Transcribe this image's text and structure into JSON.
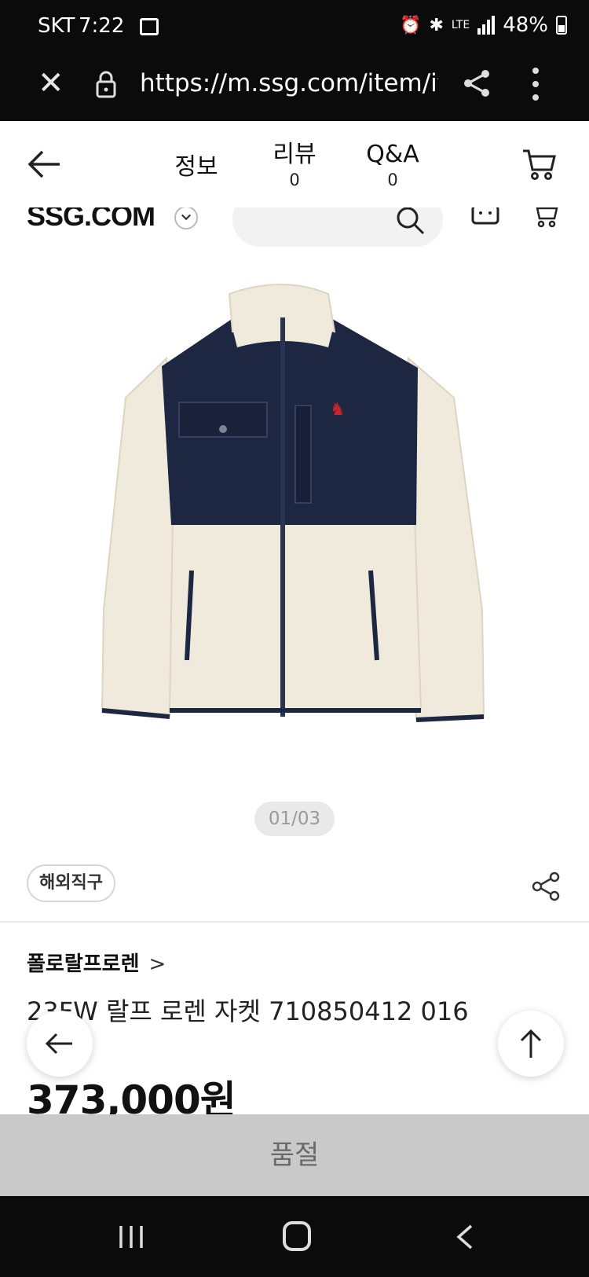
{
  "status_bar": {
    "carrier": "SKT",
    "time": "7:22",
    "network": "LTE",
    "battery": "48%",
    "icons": [
      "photo-icon",
      "alarm-icon",
      "bluetooth-icon",
      "lte-icon",
      "signal-icon",
      "battery-icon"
    ]
  },
  "browser": {
    "url": "https://m.ssg.com/item/it",
    "icons": [
      "close-icon",
      "lock-icon",
      "share-icon",
      "more-vert-icon"
    ]
  },
  "header": {
    "tabs": [
      {
        "label": "정보",
        "count": ""
      },
      {
        "label": "리뷰",
        "count": "0"
      },
      {
        "label": "Q&A",
        "count": "0"
      }
    ],
    "icons": [
      "back-arrow-icon",
      "cart-icon"
    ]
  },
  "site": {
    "logo": "SSG.COM",
    "icons": [
      "chevron-down-icon",
      "search-icon",
      "bag-icon",
      "cart-icon"
    ]
  },
  "product": {
    "image_counter": "01/03",
    "badge": "해외직구",
    "brand": "폴로랄프로렌",
    "brand_chevron": ">",
    "title": "23FW 랄프 로렌 자켓 710850412 016",
    "price": "373,000원",
    "image_description_icon": "jacket-image",
    "colors": {
      "navy": "#1e2742",
      "cream": "#efeadb",
      "red_logo": "#c8262d"
    }
  },
  "bottom": {
    "soldout_label": "품절"
  },
  "floating": {
    "icons": [
      "back-arrow-icon",
      "arrow-up-icon"
    ]
  },
  "colors": {
    "system_bar": "#0b0b0b",
    "soldout_bg": "#c9c9c9",
    "counter_bg": "#e9e9e9"
  }
}
